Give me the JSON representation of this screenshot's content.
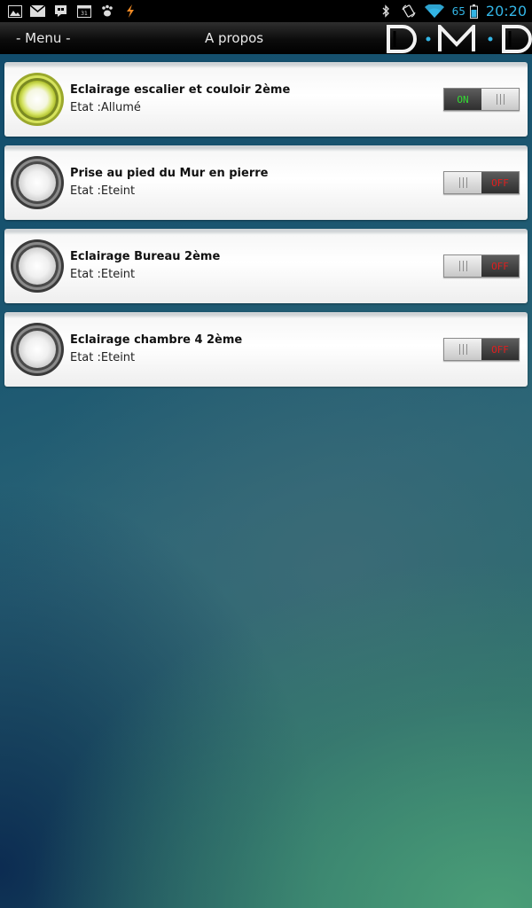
{
  "status_bar": {
    "left_icons": [
      "gallery-icon",
      "gmail-icon",
      "talk-icon",
      "calendar-icon",
      "paw-icon",
      "charging-icon"
    ],
    "right_icons": [
      "bluetooth-icon",
      "screen-rotate-icon",
      "wifi-icon"
    ],
    "battery_percent": "65",
    "time": "20:20"
  },
  "action_bar": {
    "menu_label": "- Menu -",
    "title": "A propos",
    "logo_text": "DMD"
  },
  "devices": [
    {
      "name": "Eclairage escalier et couloir 2ème",
      "state": "Etat :Allumé",
      "on": true,
      "toggle_label": "ON"
    },
    {
      "name": "Prise au pied du Mur en pierre",
      "state": "Etat :Eteint",
      "on": false,
      "toggle_label": "OFF"
    },
    {
      "name": "Eclairage Bureau 2ème",
      "state": "Etat :Eteint",
      "on": false,
      "toggle_label": "OFF"
    },
    {
      "name": "Eclairage chambre 4 2ème",
      "state": "Etat :Eteint",
      "on": false,
      "toggle_label": "OFF"
    }
  ],
  "colors": {
    "accent": "#33b5e5",
    "on_text": "#33dd33",
    "off_text": "#e01e1e",
    "lamp_on": "#c5d84a"
  }
}
